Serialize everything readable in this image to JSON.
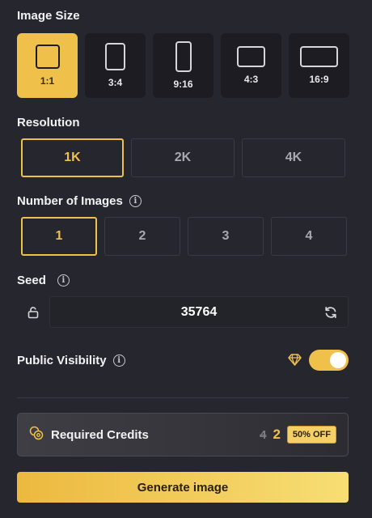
{
  "image_size": {
    "title": "Image Size",
    "options": [
      {
        "label": "1:1",
        "selected": true
      },
      {
        "label": "3:4",
        "selected": false
      },
      {
        "label": "9:16",
        "selected": false
      },
      {
        "label": "4:3",
        "selected": false
      },
      {
        "label": "16:9",
        "selected": false
      }
    ]
  },
  "resolution": {
    "title": "Resolution",
    "options": [
      {
        "label": "1K",
        "selected": true
      },
      {
        "label": "2K",
        "selected": false
      },
      {
        "label": "4K",
        "selected": false
      }
    ]
  },
  "number_of_images": {
    "title": "Number of Images",
    "info_icon": "info-icon",
    "options": [
      {
        "label": "1",
        "selected": true
      },
      {
        "label": "2",
        "selected": false
      },
      {
        "label": "3",
        "selected": false
      },
      {
        "label": "4",
        "selected": false
      }
    ]
  },
  "seed": {
    "title": "Seed",
    "info_icon": "info-icon",
    "value": "35764",
    "lock_icon": "unlock-icon",
    "refresh_icon": "refresh-icon"
  },
  "public_visibility": {
    "title": "Public Visibility",
    "info_icon": "info-icon",
    "premium_icon": "diamond-icon",
    "enabled": true
  },
  "credits": {
    "label": "Required Credits",
    "icon": "coins-icon",
    "old_value": "4",
    "new_value": "2",
    "discount_badge": "50% OFF"
  },
  "generate_button": {
    "label": "Generate image"
  },
  "colors": {
    "accent": "#f0c14a",
    "background": "#26262e",
    "tile": "#1c1c22"
  }
}
